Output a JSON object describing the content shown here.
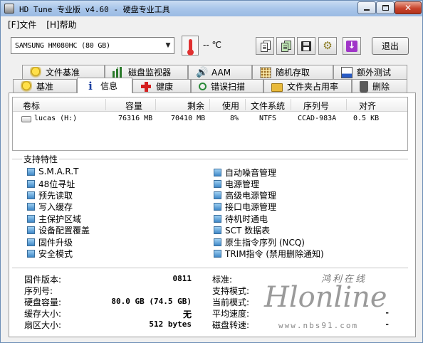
{
  "window": {
    "title": "HD Tune 专业版 v4.60 - 硬盘专业工具",
    "controls": [
      "minimize",
      "maximize",
      "close"
    ]
  },
  "menu": [
    {
      "label": "[F]文件"
    },
    {
      "label": "[H]帮助"
    }
  ],
  "toolbar": {
    "drive": "SAMSUNG HM080HC          (80 GB)",
    "temperature": "-- ℃",
    "buttons": [
      "copy-icon",
      "copy-green-icon",
      "save-icon",
      "gear-icon",
      "download-icon"
    ],
    "exit_label": "退出"
  },
  "tabs": {
    "row1": [
      {
        "label": "文件基准",
        "icon": "key-icon"
      },
      {
        "label": "磁盘监视器",
        "icon": "bar-chart-icon"
      },
      {
        "label": "AAM",
        "icon": "speaker-icon"
      },
      {
        "label": "随机存取",
        "icon": "random-dots-icon"
      },
      {
        "label": "额外测试",
        "icon": "chart-icon"
      }
    ],
    "row2": [
      {
        "label": "基准",
        "icon": "key-icon"
      },
      {
        "label": "信息",
        "icon": "info-icon",
        "active": true
      },
      {
        "label": "健康",
        "icon": "red-cross-icon"
      },
      {
        "label": "错误扫描",
        "icon": "magnifier-icon"
      },
      {
        "label": "文件夹占用率",
        "icon": "folder-icon"
      },
      {
        "label": "删除",
        "icon": "trash-icon"
      }
    ]
  },
  "volumes": {
    "headers": [
      "卷标",
      "容量",
      "剩余",
      "使用",
      "文件系统",
      "序列号",
      "对齐"
    ],
    "rows": [
      [
        "lucas (H:)",
        "76316 MB",
        "70410 MB",
        "8%",
        "NTFS",
        "CCAD-983A",
        "0.5 KB"
      ]
    ]
  },
  "features": {
    "title": "支持特性",
    "left": [
      "S.M.A.R.T",
      "48位寻址",
      "预先读取",
      "写入缓存",
      "主保护区域",
      "设备配置覆盖",
      "固件升级",
      "安全模式"
    ],
    "right": [
      "自动噪音管理",
      "电源管理",
      "高级电源管理",
      "接口电源管理",
      "待机时通电",
      "SCT 数据表",
      "原生指令序列 (NCQ)",
      "TRIM指令 (禁用删除通知)"
    ]
  },
  "info": {
    "left": [
      {
        "label": "固件版本:",
        "value": "0811"
      },
      {
        "label": "序列号:",
        "value": ""
      },
      {
        "label": "硬盘容量:",
        "value": "80.0 GB (74.5 GB)"
      },
      {
        "label": "缓存大小:",
        "value": "无"
      },
      {
        "label": "扇区大小:",
        "value": "512 bytes"
      }
    ],
    "right": [
      {
        "label": "标准:",
        "value": ""
      },
      {
        "label": "支持模式:",
        "value": ""
      },
      {
        "label": "当前模式:",
        "value": ""
      },
      {
        "label": "平均速度:",
        "value": "-"
      },
      {
        "label": "磁盘转速:",
        "value": "-"
      }
    ]
  },
  "watermark": {
    "cn": "鸿利在线",
    "logo": "Hlonline",
    "url": "www.nbs91.com"
  }
}
